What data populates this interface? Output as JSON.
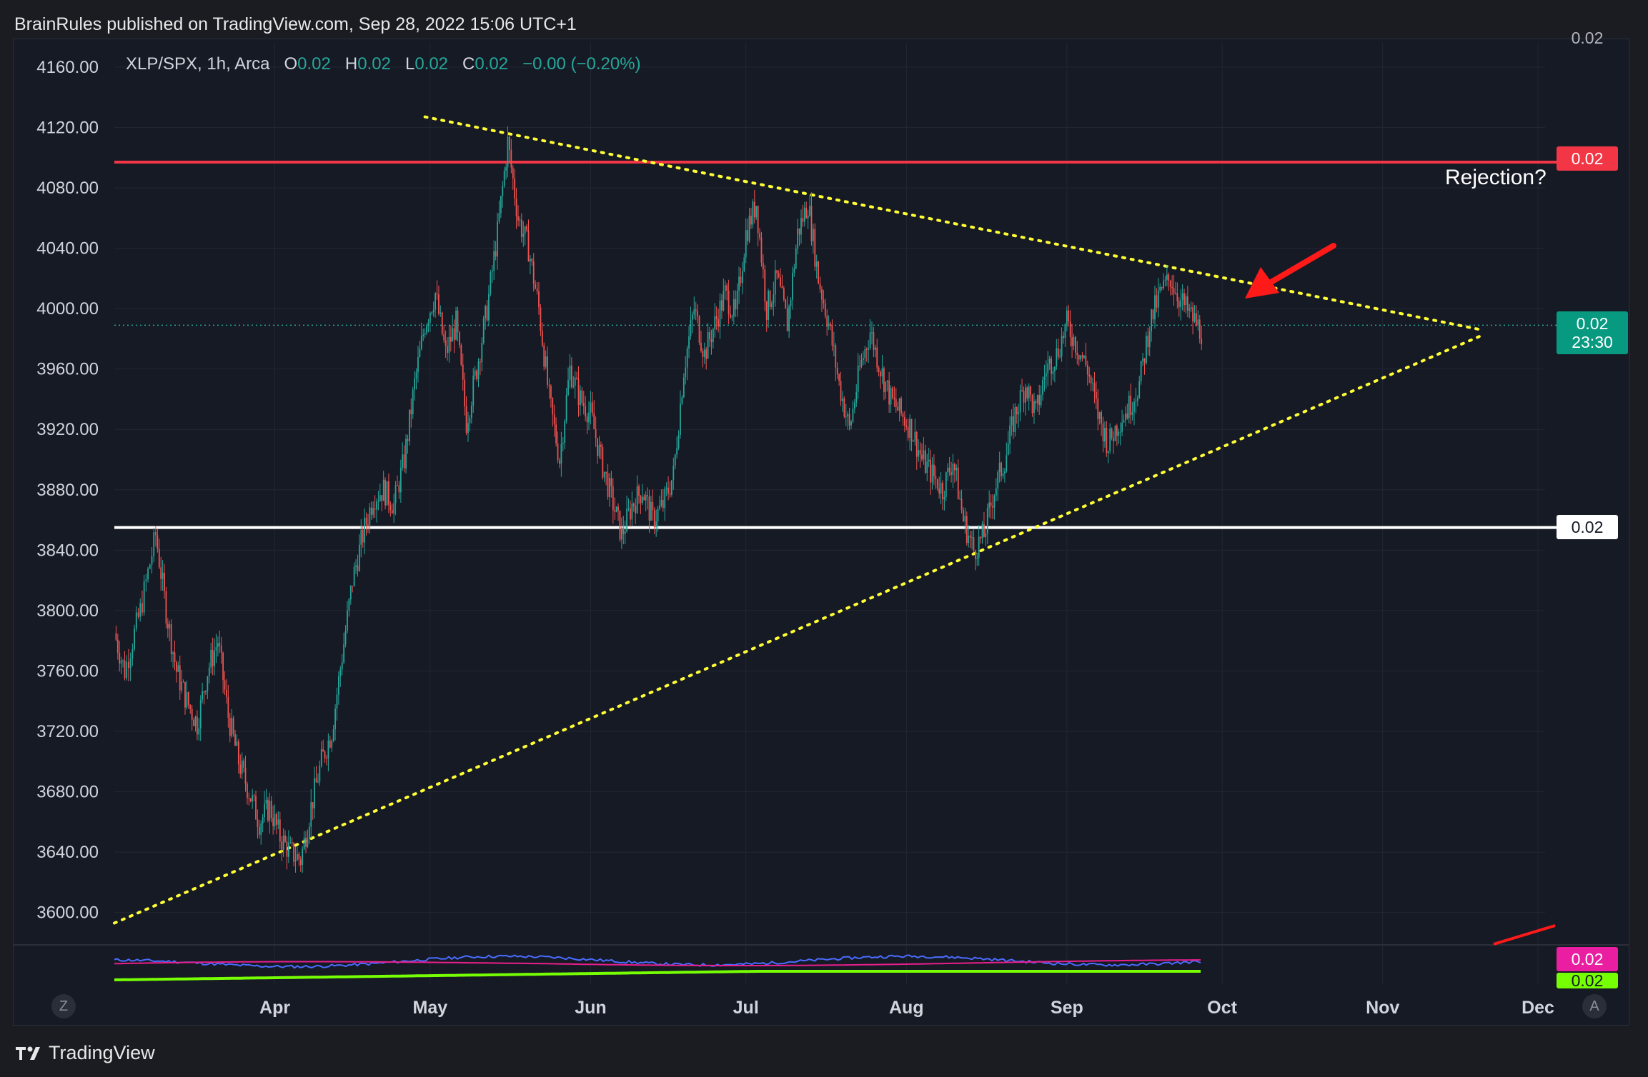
{
  "header": {
    "text": "BrainRules published on TradingView.com, Sep 28, 2022 15:06 UTC+1"
  },
  "legend": {
    "symbol": "XLP/SPX, 1h, Arca",
    "open_label": "O",
    "open_value": "0.02",
    "high_label": "H",
    "high_value": "0.02",
    "low_label": "L",
    "low_value": "0.02",
    "close_label": "C",
    "close_value": "0.02",
    "change": "−0.00 (−0.20%)"
  },
  "price_tags": {
    "red_line": "0.02",
    "last_price": "0.02",
    "countdown": "23:30",
    "white_line": "0.02",
    "indicator_top": "0.02",
    "indicator_magenta": "0.02",
    "indicator_green": "0.02"
  },
  "annotation": {
    "text": "Rejection?"
  },
  "buttons": {
    "z": "Z",
    "a": "A"
  },
  "footer": {
    "brand": "TradingView"
  },
  "colors": {
    "background": "#161a25",
    "up": "#26a69a",
    "down": "#ef5350",
    "resistance": "#f23645",
    "support": "#ffffff",
    "trendline": "#ffff33",
    "arrow": "#ff1a1a",
    "osc_blue": "#4a6cff",
    "osc_magenta": "#e91e8c",
    "osc_green": "#76ff03"
  },
  "chart_data": {
    "type": "candlestick",
    "title": "",
    "y_ticks": [
      "4160.00",
      "4120.00",
      "4080.00",
      "4040.00",
      "4000.00",
      "3960.00",
      "3920.00",
      "3880.00",
      "3840.00",
      "3800.00",
      "3760.00",
      "3720.00",
      "3680.00",
      "3640.00",
      "3600.00"
    ],
    "ylim": [
      3580,
      4176
    ],
    "x_ticks": [
      "Apr",
      "May",
      "Jun",
      "Jul",
      "Aug",
      "Sep",
      "Oct",
      "Nov",
      "Dec"
    ],
    "grid": true,
    "horizontal_lines": [
      {
        "name": "resistance",
        "value": 4097,
        "color": "#f23645"
      },
      {
        "name": "support",
        "value": 3855,
        "color": "#ffffff"
      }
    ],
    "last_price_level": 3989,
    "trendlines": [
      {
        "name": "upper",
        "from": [
          "2022-04-30",
          4127
        ],
        "to": [
          "2022-11-20",
          3986
        ],
        "style": "dotted"
      },
      {
        "name": "lower",
        "from": [
          "2022-03-01",
          3593
        ],
        "to": [
          "2022-11-20",
          3982
        ],
        "style": "dotted"
      }
    ],
    "series_path": [
      [
        "2022-03-01",
        3785
      ],
      [
        "2022-03-03",
        3760
      ],
      [
        "2022-03-06",
        3800
      ],
      [
        "2022-03-09",
        3850
      ],
      [
        "2022-03-11",
        3800
      ],
      [
        "2022-03-13",
        3760
      ],
      [
        "2022-03-15",
        3740
      ],
      [
        "2022-03-17",
        3725
      ],
      [
        "2022-03-19",
        3760
      ],
      [
        "2022-03-21",
        3780
      ],
      [
        "2022-03-23",
        3730
      ],
      [
        "2022-03-25",
        3700
      ],
      [
        "2022-03-27",
        3680
      ],
      [
        "2022-03-29",
        3660
      ],
      [
        "2022-03-31",
        3670
      ],
      [
        "2022-04-02",
        3650
      ],
      [
        "2022-04-04",
        3640
      ],
      [
        "2022-04-06",
        3635
      ],
      [
        "2022-04-08",
        3670
      ],
      [
        "2022-04-10",
        3700
      ],
      [
        "2022-04-12",
        3720
      ],
      [
        "2022-04-14",
        3770
      ],
      [
        "2022-04-16",
        3820
      ],
      [
        "2022-04-18",
        3850
      ],
      [
        "2022-04-20",
        3875
      ],
      [
        "2022-04-22",
        3880
      ],
      [
        "2022-04-24",
        3870
      ],
      [
        "2022-04-26",
        3900
      ],
      [
        "2022-04-28",
        3950
      ],
      [
        "2022-04-30",
        3990
      ],
      [
        "2022-05-02",
        4010
      ],
      [
        "2022-05-04",
        3970
      ],
      [
        "2022-05-06",
        3990
      ],
      [
        "2022-05-08",
        3925
      ],
      [
        "2022-05-10",
        3960
      ],
      [
        "2022-05-12",
        4000
      ],
      [
        "2022-05-14",
        4050
      ],
      [
        "2022-05-16",
        4110
      ],
      [
        "2022-05-18",
        4060
      ],
      [
        "2022-05-20",
        4040
      ],
      [
        "2022-05-22",
        4000
      ],
      [
        "2022-05-24",
        3940
      ],
      [
        "2022-05-26",
        3900
      ],
      [
        "2022-05-28",
        3960
      ],
      [
        "2022-05-30",
        3940
      ],
      [
        "2022-06-01",
        3930
      ],
      [
        "2022-06-03",
        3900
      ],
      [
        "2022-06-05",
        3875
      ],
      [
        "2022-06-07",
        3850
      ],
      [
        "2022-06-09",
        3870
      ],
      [
        "2022-06-11",
        3880
      ],
      [
        "2022-06-13",
        3860
      ],
      [
        "2022-06-15",
        3870
      ],
      [
        "2022-06-17",
        3890
      ],
      [
        "2022-06-19",
        3960
      ],
      [
        "2022-06-21",
        4000
      ],
      [
        "2022-06-23",
        3970
      ],
      [
        "2022-06-25",
        3990
      ],
      [
        "2022-06-27",
        4010
      ],
      [
        "2022-06-29",
        3995
      ],
      [
        "2022-07-01",
        4050
      ],
      [
        "2022-07-03",
        4070
      ],
      [
        "2022-07-05",
        4000
      ],
      [
        "2022-07-07",
        4020
      ],
      [
        "2022-07-09",
        3990
      ],
      [
        "2022-07-11",
        4050
      ],
      [
        "2022-07-13",
        4070
      ],
      [
        "2022-07-15",
        4020
      ],
      [
        "2022-07-17",
        3990
      ],
      [
        "2022-07-19",
        3950
      ],
      [
        "2022-07-21",
        3920
      ],
      [
        "2022-07-23",
        3960
      ],
      [
        "2022-07-25",
        3985
      ],
      [
        "2022-07-27",
        3960
      ],
      [
        "2022-07-29",
        3940
      ],
      [
        "2022-07-31",
        3930
      ],
      [
        "2022-08-02",
        3920
      ],
      [
        "2022-08-04",
        3900
      ],
      [
        "2022-08-06",
        3890
      ],
      [
        "2022-08-08",
        3880
      ],
      [
        "2022-08-10",
        3900
      ],
      [
        "2022-08-12",
        3860
      ],
      [
        "2022-08-14",
        3840
      ],
      [
        "2022-08-16",
        3850
      ],
      [
        "2022-08-18",
        3880
      ],
      [
        "2022-08-20",
        3900
      ],
      [
        "2022-08-22",
        3930
      ],
      [
        "2022-08-24",
        3950
      ],
      [
        "2022-08-26",
        3930
      ],
      [
        "2022-08-28",
        3960
      ],
      [
        "2022-08-30",
        3970
      ],
      [
        "2022-09-01",
        3990
      ],
      [
        "2022-09-03",
        3975
      ],
      [
        "2022-09-05",
        3960
      ],
      [
        "2022-09-07",
        3930
      ],
      [
        "2022-09-09",
        3910
      ],
      [
        "2022-09-11",
        3925
      ],
      [
        "2022-09-13",
        3935
      ],
      [
        "2022-09-15",
        3950
      ],
      [
        "2022-09-17",
        3990
      ],
      [
        "2022-09-19",
        4010
      ],
      [
        "2022-09-21",
        4020
      ],
      [
        "2022-09-23",
        4005
      ],
      [
        "2022-09-25",
        3995
      ],
      [
        "2022-09-27",
        3985
      ]
    ],
    "oscillator": {
      "series": [
        {
          "color": "#4a6cff",
          "style": "fast"
        },
        {
          "color": "#e91e8c",
          "style": "slow"
        },
        {
          "color": "#76ff03",
          "style": "baseline"
        }
      ]
    }
  }
}
